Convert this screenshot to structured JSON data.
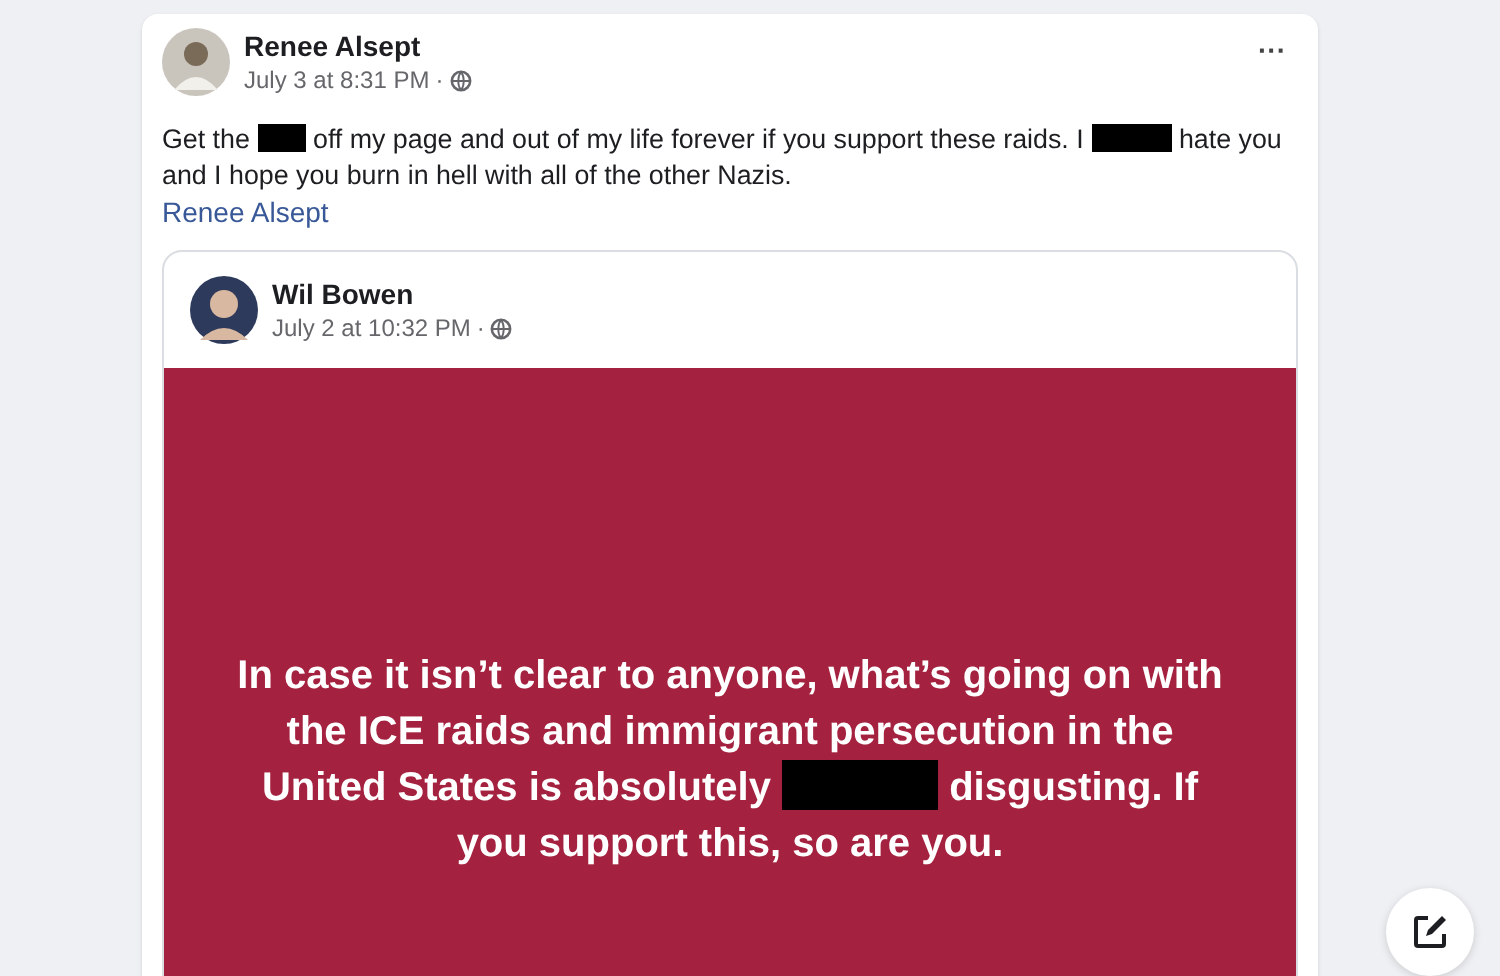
{
  "post": {
    "author": "Renee Alsept",
    "time": "July 3 at 8:31 PM",
    "separator": "·",
    "menu": "···",
    "text": [
      {
        "kind": "text",
        "text": "Get the"
      },
      {
        "kind": "shortredaction"
      },
      {
        "kind": "text",
        "text": "off my page and out of my life forever if you support these raids. I"
      },
      {
        "kind": "redaction"
      },
      {
        "kind": "text",
        "text": "hate you and I hope you burn in hell with all of the other Nazis."
      }
    ],
    "tag_link": "Renee Alsept",
    "shared": {
      "author": "Wil Bowen",
      "time": "July 2 at 10:32 PM",
      "separator": "·",
      "text": [
        {
          "kind": "text",
          "text": "In case it isn’t clear to anyone, what’s going on with the ICE raids and immigrant persecution in the United States is absolutely"
        },
        {
          "kind": "longredaction"
        },
        {
          "kind": "text",
          "text": "disgusting. If you support this, so are you."
        }
      ]
    }
  }
}
